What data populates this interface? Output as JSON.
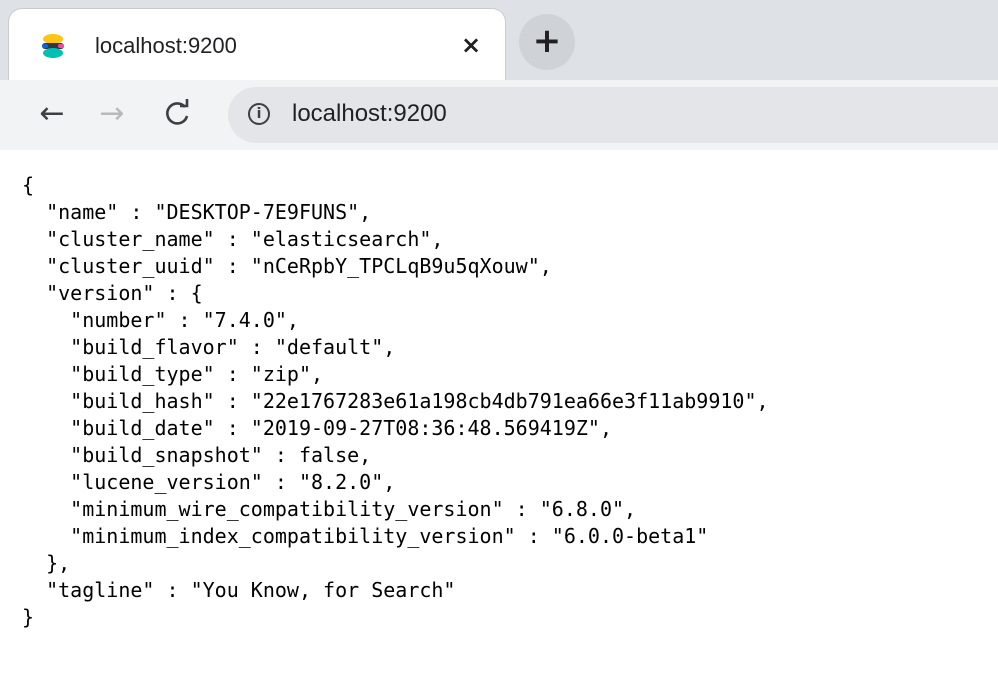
{
  "tab": {
    "title": "localhost:9200",
    "close_glyph": "×",
    "favicon": "elastic-icon"
  },
  "new_tab": {
    "glyph": "+"
  },
  "toolbar": {
    "back_glyph": "←",
    "forward_glyph": "→",
    "reload_glyph": "C",
    "info_glyph": "i",
    "url": "localhost:9200"
  },
  "json_lines": [
    "{",
    "  \"name\" : \"DESKTOP-7E9FUNS\",",
    "  \"cluster_name\" : \"elasticsearch\",",
    "  \"cluster_uuid\" : \"nCeRpbY_TPCLqB9u5qXouw\",",
    "  \"version\" : {",
    "    \"number\" : \"7.4.0\",",
    "    \"build_flavor\" : \"default\",",
    "    \"build_type\" : \"zip\",",
    "    \"build_hash\" : \"22e1767283e61a198cb4db791ea66e3f11ab9910\",",
    "    \"build_date\" : \"2019-09-27T08:36:48.569419Z\",",
    "    \"build_snapshot\" : false,",
    "    \"lucene_version\" : \"8.2.0\",",
    "    \"minimum_wire_compatibility_version\" : \"6.8.0\",",
    "    \"minimum_index_compatibility_version\" : \"6.0.0-beta1\"",
    "  },",
    "  \"tagline\" : \"You Know, for Search\"",
    "}"
  ],
  "colors": {
    "tabstrip_bg": "#dee1e6",
    "tab_bg": "#ffffff",
    "omnibox_bg": "#e3e5e8",
    "text": "#202124",
    "favicon_yellow": "#fec514",
    "favicon_teal": "#00bfb3",
    "favicon_pink": "#f04e98",
    "favicon_blue": "#0b64dd"
  }
}
